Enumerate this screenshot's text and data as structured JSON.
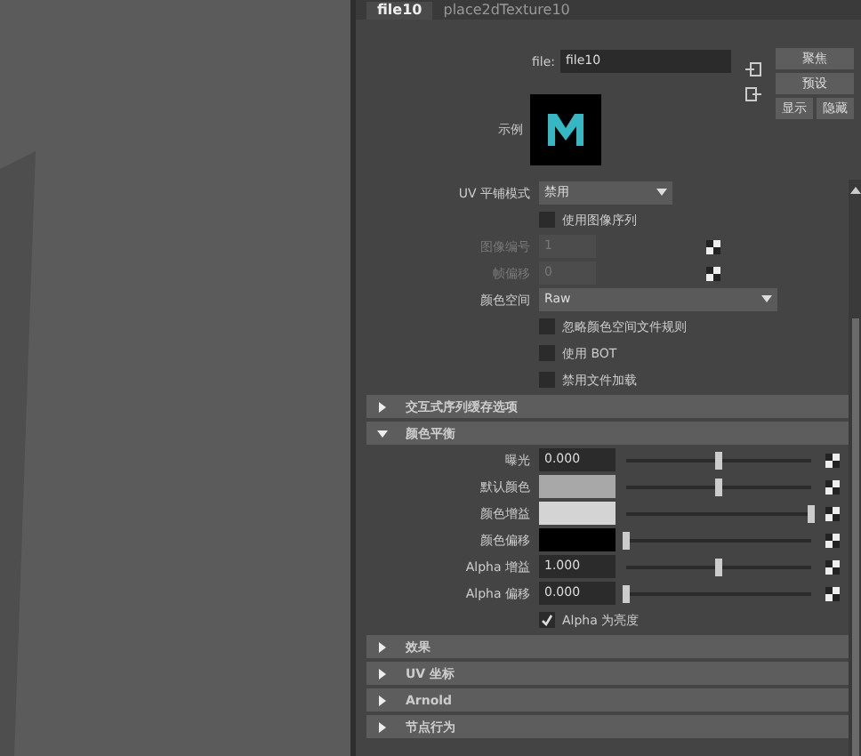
{
  "tabs": [
    {
      "label": "file10",
      "selected": true
    },
    {
      "label": "place2dTexture10",
      "selected": false
    }
  ],
  "file": {
    "label": "file:",
    "value": "file10"
  },
  "buttons": [
    "聚焦",
    "预设",
    "显示",
    "隐藏"
  ],
  "sample": {
    "label": "示例"
  },
  "rows": [
    {
      "kind": "dropdown",
      "label": "UV 平铺模式",
      "value": "禁用",
      "wide": false
    },
    {
      "kind": "checkbox",
      "label": "使用图像序列",
      "checked": false
    },
    {
      "kind": "number",
      "label": "图像编号",
      "value": "1",
      "disabled": true
    },
    {
      "kind": "number",
      "label": "帧偏移",
      "value": "0",
      "disabled": true
    },
    {
      "kind": "dropdown",
      "label": "颜色空间",
      "value": "Raw",
      "wide": true
    },
    {
      "kind": "checkbox",
      "label": "忽略颜色空间文件规则",
      "checked": false
    },
    {
      "kind": "checkbox",
      "label": "使用 BOT",
      "checked": false
    },
    {
      "kind": "checkbox",
      "label": "禁用文件加载",
      "checked": false
    }
  ],
  "sections": [
    {
      "title": "交互式序列缓存选项",
      "expanded": false
    },
    {
      "title": "颜色平衡",
      "expanded": true,
      "rows": [
        {
          "kind": "num_slider",
          "label": "曝光",
          "value": "0.000",
          "level": 0.5
        },
        {
          "kind": "color_slider",
          "label": "默认颜色",
          "color": "#a8a8a8",
          "level": 0.5
        },
        {
          "kind": "color_slider",
          "label": "颜色增益",
          "color": "#d4d4d4",
          "level": 1
        },
        {
          "kind": "color_slider",
          "label": "颜色偏移",
          "color": "#000000",
          "level": 0
        },
        {
          "kind": "num_slider",
          "label": "Alpha 增益",
          "value": "1.000",
          "level": 0.5
        },
        {
          "kind": "num_slider",
          "label": "Alpha 偏移",
          "value": "0.000",
          "level": 0
        },
        {
          "kind": "checkbox",
          "label": "Alpha 为亮度",
          "checked": true
        }
      ]
    },
    {
      "title": "效果",
      "expanded": false
    },
    {
      "title": "UV 坐标",
      "expanded": false
    },
    {
      "title": "Arnold",
      "expanded": false
    },
    {
      "title": "节点行为",
      "expanded": false
    }
  ]
}
